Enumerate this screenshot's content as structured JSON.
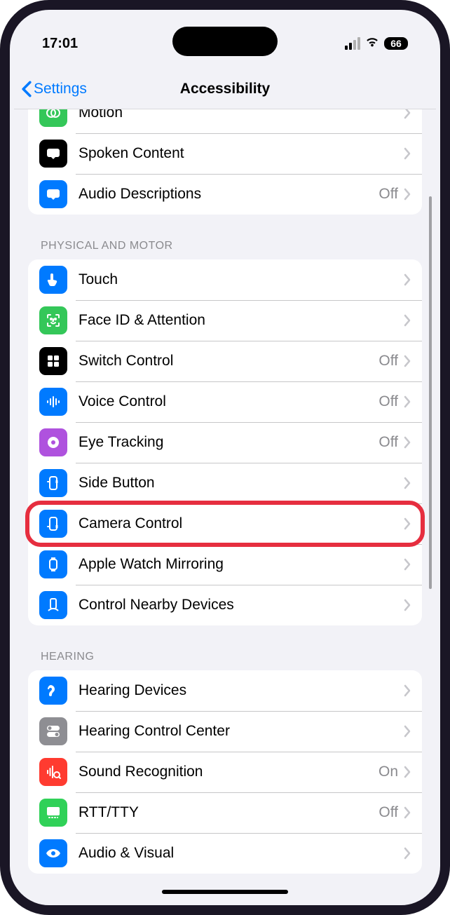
{
  "status": {
    "time": "17:01",
    "battery": "66"
  },
  "nav": {
    "back": "Settings",
    "title": "Accessibility"
  },
  "sections": {
    "vision_rows": [
      {
        "label": "Motion",
        "value": "",
        "icon": "motion-icon",
        "bg": "bg-green"
      },
      {
        "label": "Spoken Content",
        "value": "",
        "icon": "spoken-content-icon",
        "bg": "bg-black"
      },
      {
        "label": "Audio Descriptions",
        "value": "Off",
        "icon": "audio-descriptions-icon",
        "bg": "bg-blue"
      }
    ],
    "physical_header": "PHYSICAL AND MOTOR",
    "physical_rows": [
      {
        "label": "Touch",
        "value": "",
        "icon": "touch-icon",
        "bg": "bg-blue"
      },
      {
        "label": "Face ID & Attention",
        "value": "",
        "icon": "faceid-icon",
        "bg": "bg-green"
      },
      {
        "label": "Switch Control",
        "value": "Off",
        "icon": "switch-control-icon",
        "bg": "bg-black"
      },
      {
        "label": "Voice Control",
        "value": "Off",
        "icon": "voice-control-icon",
        "bg": "bg-blue"
      },
      {
        "label": "Eye Tracking",
        "value": "Off",
        "icon": "eye-tracking-icon",
        "bg": "bg-purple"
      },
      {
        "label": "Side Button",
        "value": "",
        "icon": "side-button-icon",
        "bg": "bg-blue"
      },
      {
        "label": "Camera Control",
        "value": "",
        "icon": "camera-control-icon",
        "bg": "bg-blue"
      },
      {
        "label": "Apple Watch Mirroring",
        "value": "",
        "icon": "watch-mirroring-icon",
        "bg": "bg-blue"
      },
      {
        "label": "Control Nearby Devices",
        "value": "",
        "icon": "nearby-devices-icon",
        "bg": "bg-blue"
      }
    ],
    "hearing_header": "HEARING",
    "hearing_rows": [
      {
        "label": "Hearing Devices",
        "value": "",
        "icon": "hearing-devices-icon",
        "bg": "bg-blue"
      },
      {
        "label": "Hearing Control Center",
        "value": "",
        "icon": "hearing-control-icon",
        "bg": "bg-gray"
      },
      {
        "label": "Sound Recognition",
        "value": "On",
        "icon": "sound-recognition-icon",
        "bg": "bg-red"
      },
      {
        "label": "RTT/TTY",
        "value": "Off",
        "icon": "rtt-tty-icon",
        "bg": "bg-greenlt"
      },
      {
        "label": "Audio & Visual",
        "value": "",
        "icon": "audio-visual-icon",
        "bg": "bg-blue"
      }
    ]
  },
  "highlight_row": "Camera Control"
}
